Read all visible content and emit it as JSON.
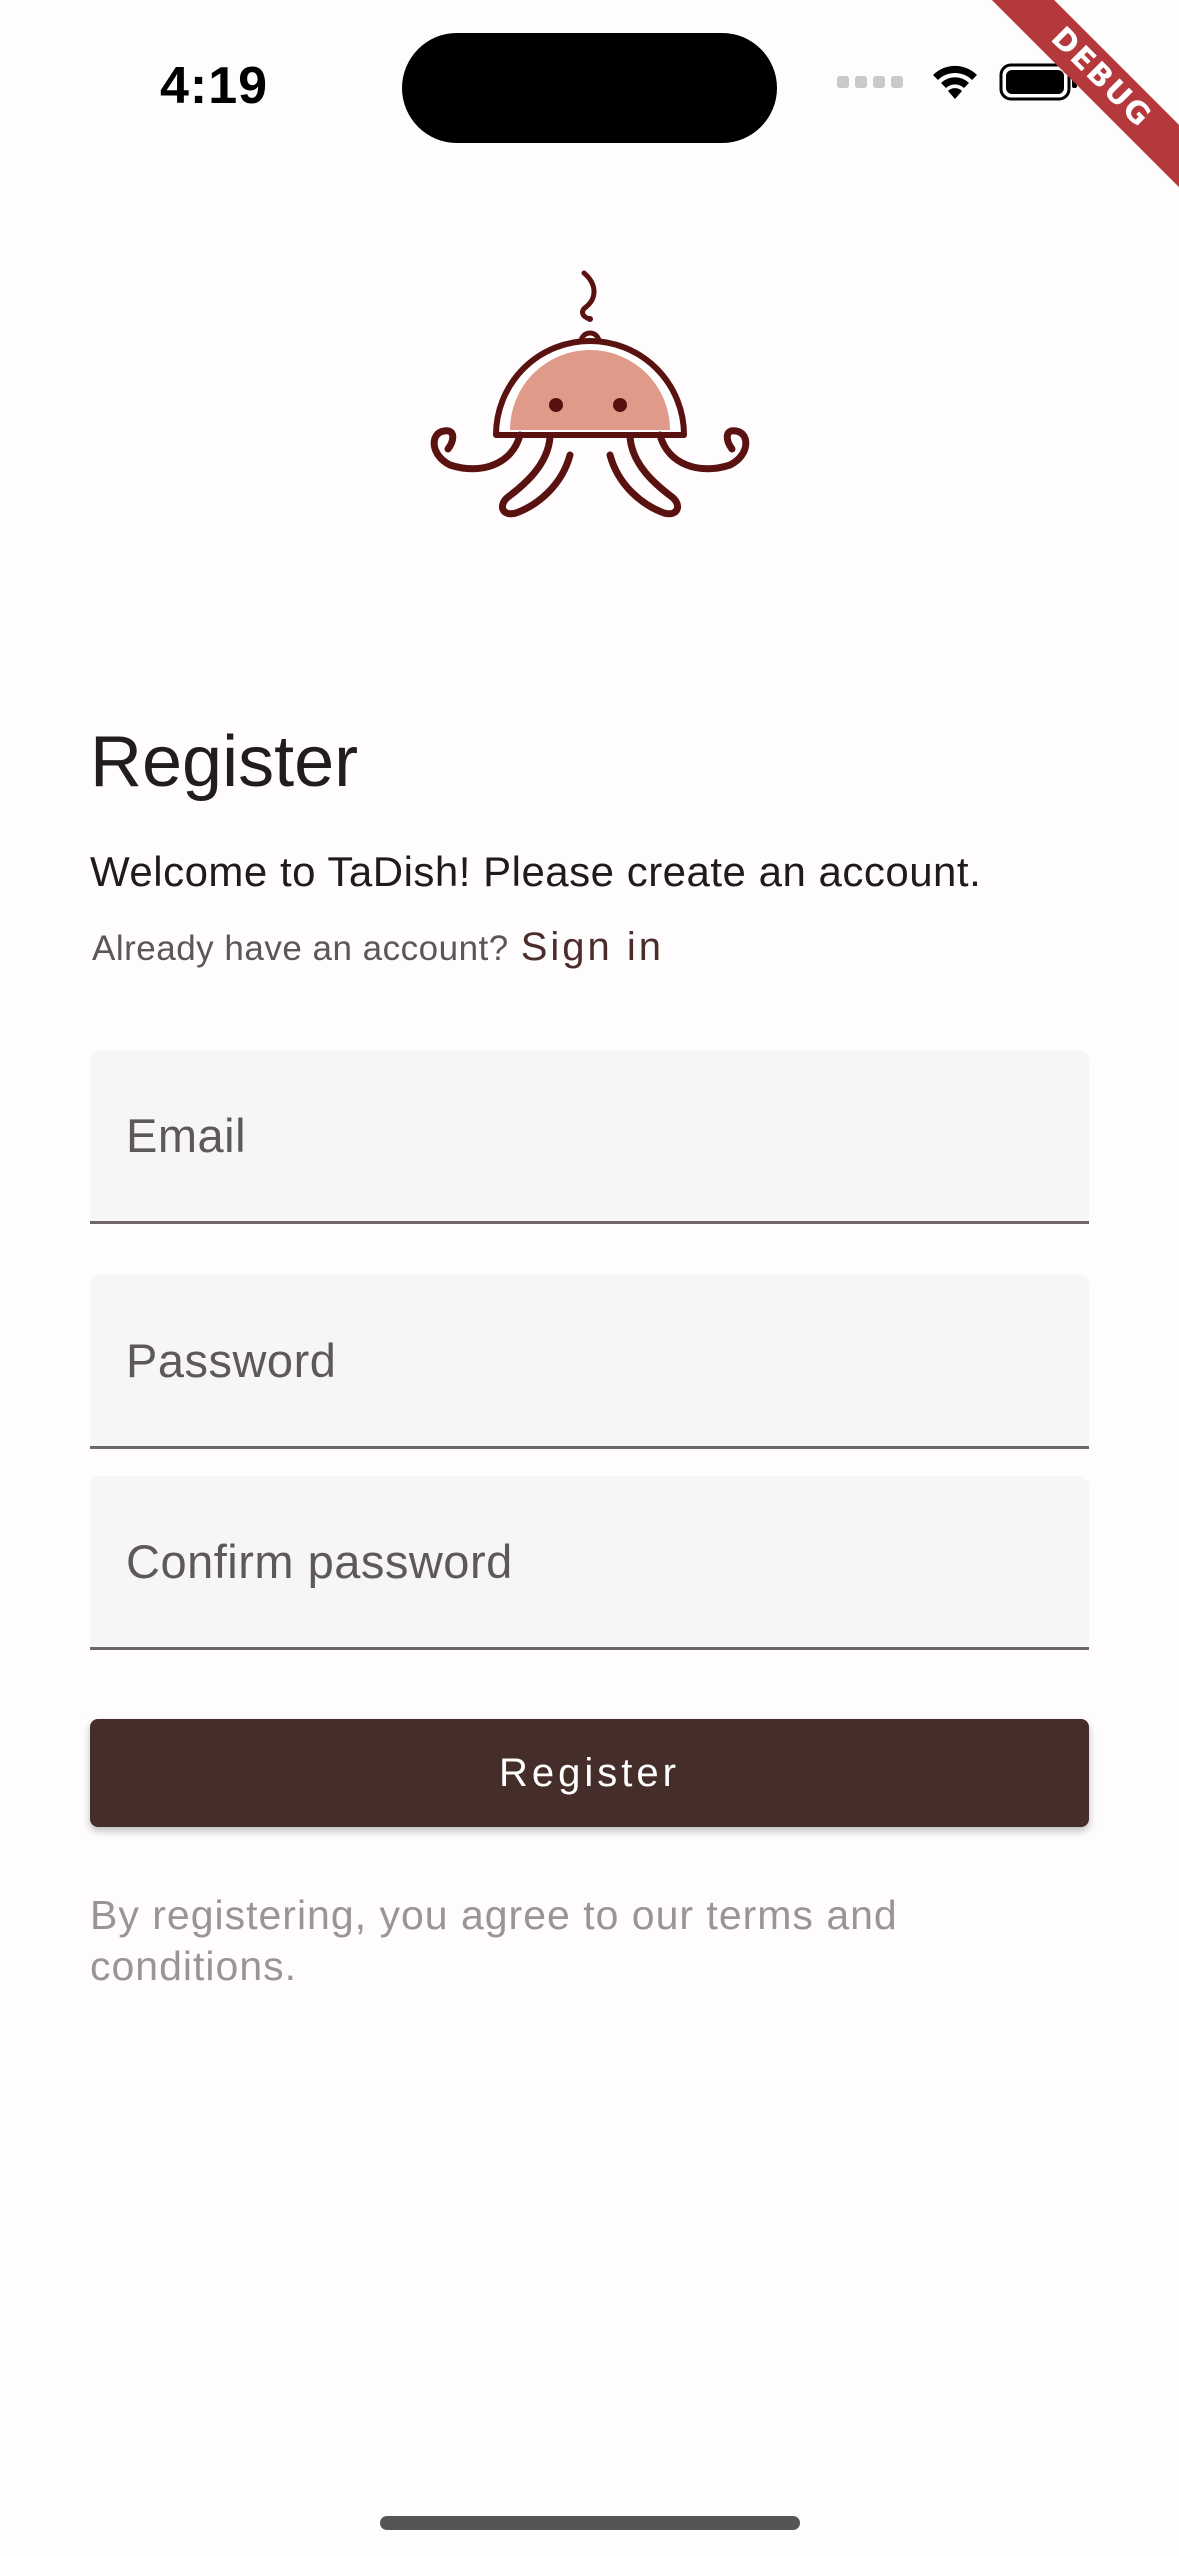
{
  "status_bar": {
    "time": "4:19"
  },
  "debug_banner": {
    "label": "DEBUG"
  },
  "logo": {
    "icon": "tadish-octopus-logo",
    "colors": {
      "outline": "#5a1210",
      "fill": "#e09a8a"
    }
  },
  "register_page": {
    "title": "Register",
    "welcome": "Welcome to TaDish! Please create an account.",
    "signin_prompt": "Already have an account?",
    "signin_link": "Sign in",
    "email_placeholder": "Email",
    "email_value": "",
    "password_placeholder": "Password",
    "password_value": "",
    "confirm_password_placeholder": "Confirm password",
    "confirm_password_value": "",
    "register_button": "Register",
    "terms": "By registering, you agree to our terms and conditions."
  },
  "colors": {
    "primary": "#452d2a",
    "link": "#4a2d2a",
    "field_bg": "#f7f6f6",
    "debug_red": "#b5383c"
  }
}
